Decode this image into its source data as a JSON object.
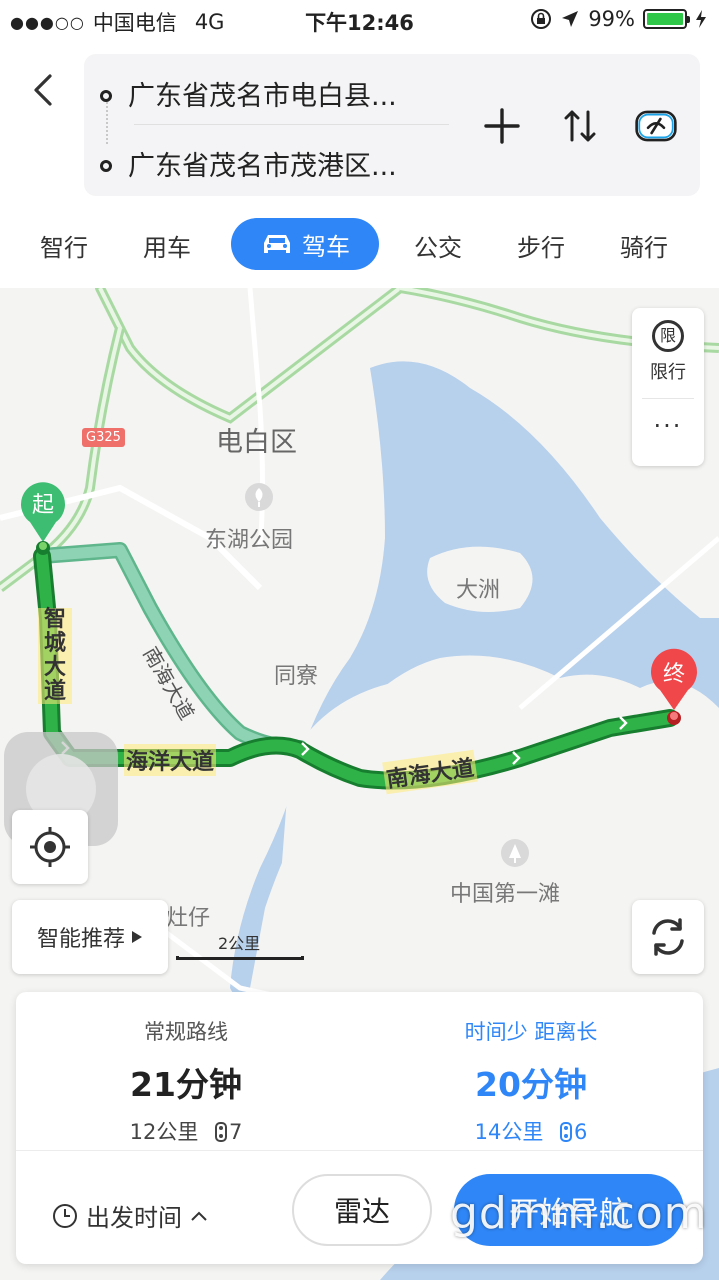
{
  "status_bar": {
    "signal": "●●●○○",
    "carrier": "中国电信",
    "network": "4G",
    "time": "下午12:46",
    "battery": "99%",
    "battery_level": 0.99
  },
  "route": {
    "start": "广东省茂名市电白县...",
    "end": "广东省茂名市茂港区..."
  },
  "tabs": [
    "智行",
    "用车",
    "驾车",
    "公交",
    "步行",
    "骑行"
  ],
  "active_tab": "驾车",
  "map": {
    "labels": {
      "district": "电白区",
      "park": "东湖公园",
      "island": "大洲",
      "village": "同寮",
      "beach": "中国第一滩",
      "town": "灶仔",
      "highway": "G325"
    },
    "roads": {
      "zhicheng": "智城大道",
      "haiyang": "海洋大道",
      "nanhai": "南海大道"
    },
    "start_marker": "起",
    "end_marker": "终",
    "limit_icon": "限",
    "limit_label": "限行",
    "more": "···",
    "smart_recommend": "智能推荐",
    "scale": "2公里"
  },
  "options": [
    {
      "tag": "常规路线",
      "time": "21分钟",
      "distance": "12公里",
      "lights": "7"
    },
    {
      "tag": "时间少  距离长",
      "time": "20分钟",
      "distance": "14公里",
      "lights": "6"
    }
  ],
  "actions": {
    "depart_time": "出发时间",
    "radar": "雷达",
    "start_nav": "开始导航"
  },
  "watermark": "gdmm.com",
  "colors": {
    "accent": "#2f86f6",
    "route_main": "#1a9f3a",
    "route_alt": "#7cc9a8",
    "water": "#b7d0ec",
    "start_marker": "#3dbd72",
    "end_marker": "#f0474a"
  }
}
